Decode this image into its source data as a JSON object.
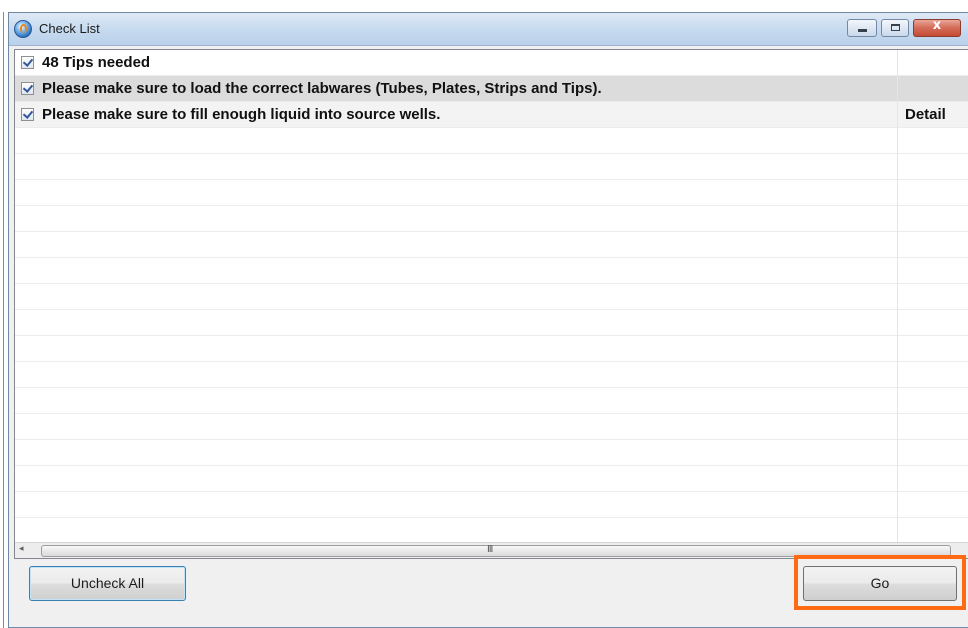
{
  "window": {
    "title": "Check List",
    "close_glyph": "x",
    "icon": "app-globe-icon"
  },
  "checklist": {
    "items": [
      {
        "text": "48 Tips needed",
        "checked": true,
        "detail": ""
      },
      {
        "text": "Please make sure to load the correct labwares (Tubes, Plates, Strips and Tips).",
        "checked": true,
        "detail": ""
      },
      {
        "text": "Please make sure to fill enough liquid into source wells.",
        "checked": true,
        "detail": "Detail"
      }
    ]
  },
  "scrollbar": {
    "left_arrow": "◂",
    "grip": "III"
  },
  "buttons": {
    "uncheck_all": "Uncheck All",
    "go": "Go"
  },
  "colors": {
    "highlight": "#ff6a13",
    "titlebar": "#c9dcf0",
    "close_button": "#c44a33",
    "selected_row": "#dcdcdc"
  }
}
